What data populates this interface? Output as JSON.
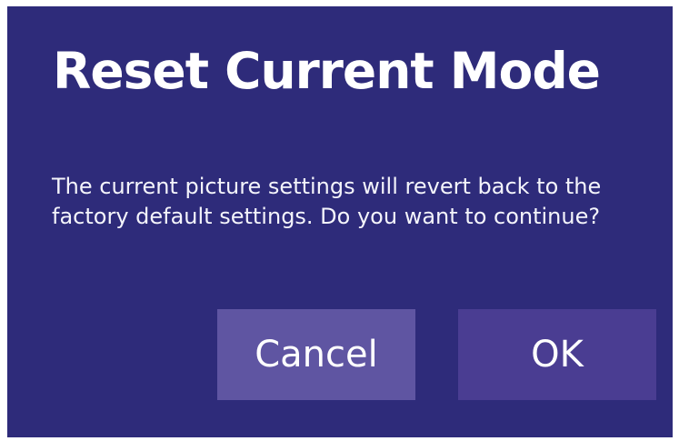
{
  "dialog": {
    "title": "Reset Current Mode",
    "message": "The current picture settings will revert back to the factory default settings. Do you want to continue?",
    "buttons": {
      "cancel_label": "Cancel",
      "ok_label": "OK"
    }
  },
  "colors": {
    "dialog_background": "#2e2b7a",
    "cancel_button": "#5f55a2",
    "ok_button": "#4a3d92",
    "text": "#ffffff"
  }
}
